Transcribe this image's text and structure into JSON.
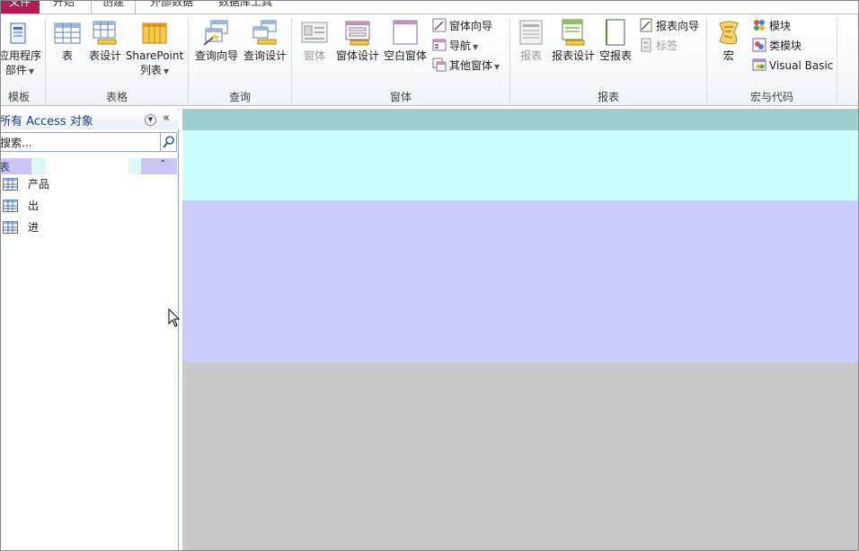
{
  "tabs": {
    "file": "文件",
    "home": "开始",
    "create": "创建",
    "external": "外部数据",
    "dbtools": "数据库工具"
  },
  "groups": {
    "templates": {
      "label": "模板",
      "app_parts_line1": "应用程序",
      "app_parts_line2": "部件"
    },
    "tables": {
      "label": "表格",
      "table": "表",
      "table_design": "表设计",
      "sharepoint_line1": "SharePoint",
      "sharepoint_line2": "列表"
    },
    "queries": {
      "label": "查询",
      "query_wizard": "查询向导",
      "query_design": "查询设计"
    },
    "forms": {
      "label": "窗体",
      "form": "窗体",
      "form_design": "窗体设计",
      "blank_form": "空白窗体",
      "form_wizard": "窗体向导",
      "navigation": "导航",
      "more_forms": "其他窗体"
    },
    "reports": {
      "label": "报表",
      "report": "报表",
      "report_design": "报表设计",
      "blank_report": "空报表",
      "report_wizard": "报表向导",
      "labels": "标签"
    },
    "macros": {
      "label": "宏与代码",
      "macro": "宏",
      "module": "模块",
      "class_module": "类模块",
      "visual_basic": "Visual Basic"
    }
  },
  "nav": {
    "title": "所有 Access 对象",
    "search_value": "搜索...",
    "category": "表",
    "items": [
      {
        "label": "产品"
      },
      {
        "label": "出"
      },
      {
        "label": "进"
      }
    ]
  },
  "colors": {
    "file_tab": "#b41b56",
    "band_teal": "#9ecfcf",
    "band_cyan": "#ccffff",
    "band_lavender": "#ccccff",
    "workspace_gray": "#c8c8c8"
  }
}
